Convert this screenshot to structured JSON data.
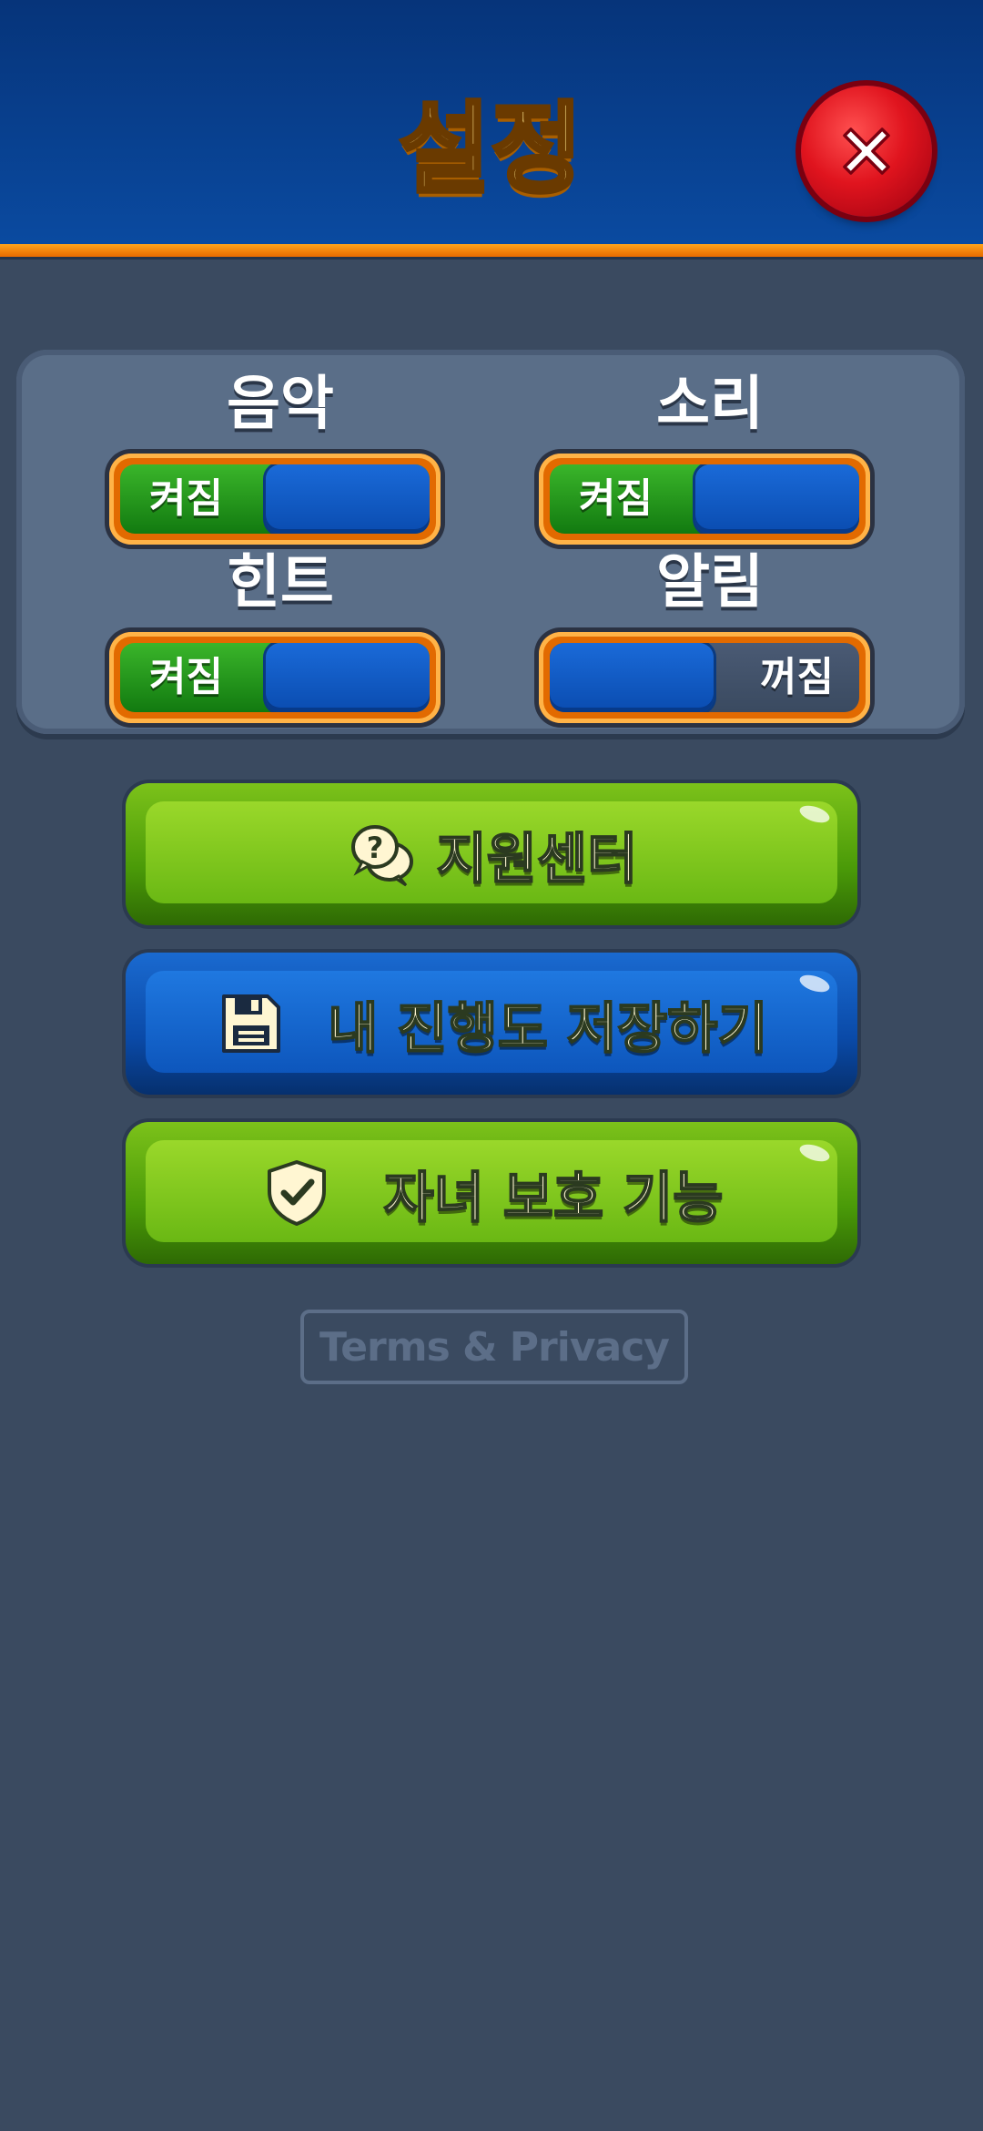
{
  "header": {
    "title": "설정",
    "close_icon": "close-x-icon"
  },
  "settings": [
    {
      "label": "음악",
      "state_text": "켜짐",
      "on": true
    },
    {
      "label": "소리",
      "state_text": "켜짐",
      "on": true
    },
    {
      "label": "힌트",
      "state_text": "켜짐",
      "on": true
    },
    {
      "label": "알림",
      "state_text": "꺼짐",
      "on": false
    }
  ],
  "buttons": {
    "support": {
      "label": "지원센터",
      "icon": "help-chat-icon"
    },
    "save": {
      "label": "내 진행도 저장하기",
      "icon": "floppy-disk-icon"
    },
    "parental": {
      "label": "자녀 보호 기능",
      "icon": "shield-check-icon"
    }
  },
  "footer": {
    "terms_label": "Terms & Privacy"
  },
  "colors": {
    "header": "#0a4aa0",
    "accent_orange": "#ffa31a",
    "background": "#3a4a60",
    "green_button": "#6ab814",
    "blue_button": "#0d56bc",
    "close_red": "#e0141e"
  }
}
